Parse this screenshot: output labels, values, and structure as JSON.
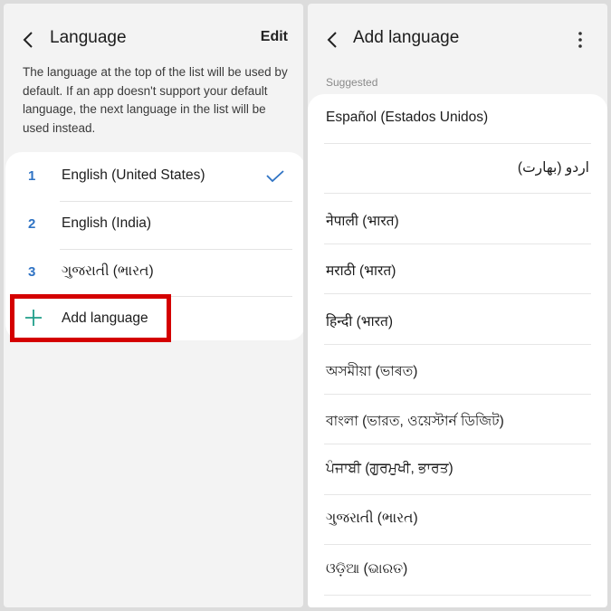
{
  "left_screen": {
    "title": "Language",
    "edit_label": "Edit",
    "description": "The language at the top of the list will be used by default. If an app doesn't support your default language, the next language in the list will be used instead.",
    "languages": [
      {
        "number": "1",
        "label": "English (United States)",
        "selected": true
      },
      {
        "number": "2",
        "label": "English (India)"
      },
      {
        "number": "3",
        "label": "ગુજરાતી (ભારત)"
      }
    ],
    "add_label": "Add language",
    "highlight_color": "#d40000",
    "number_color": "#2f73c4",
    "plus_color": "#1f9e8a"
  },
  "right_screen": {
    "title": "Add language",
    "section_label": "Suggested",
    "suggestions": [
      {
        "label": "Español (Estados Unidos)"
      },
      {
        "label": "اردو (بھارت)"
      },
      {
        "label": "नेपाली (भारत)"
      },
      {
        "label": "मराठी (भारत)"
      },
      {
        "label": "हिन्दी (भारत)"
      },
      {
        "label": "অসমীয়া (ভাৰত)"
      },
      {
        "label": "বাংলা (ভারত, ওয়েস্টার্ন ডিজিট)"
      },
      {
        "label": "ਪੰਜਾਬੀ (ਗੁਰਮੁਖੀ, ਭਾਰਤ)"
      },
      {
        "label": "ગુજરાતી (ભારત)"
      },
      {
        "label": "ଓଡ଼ିଆ (ଭାରତ)"
      }
    ]
  }
}
